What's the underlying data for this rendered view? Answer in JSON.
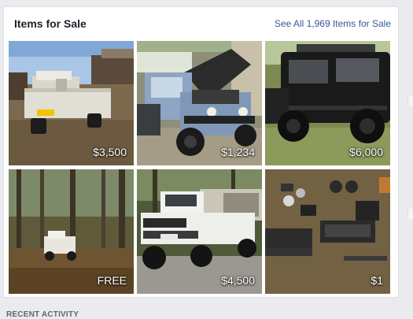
{
  "section": {
    "title": "Items for Sale",
    "see_all": "See All 1,969 Items for Sale"
  },
  "items": [
    {
      "price": "$3,500",
      "photo": "white-tray-ute-in-yard"
    },
    {
      "price": "$1,234",
      "photo": "blue-suzuki-hood-open"
    },
    {
      "price": "$6,000",
      "photo": "black-suzuki-4x4"
    },
    {
      "price": "FREE",
      "photo": "white-ute-in-bush"
    },
    {
      "price": "$4,500",
      "photo": "white-nissan-tray-ute"
    },
    {
      "price": "$1",
      "photo": "car-parts-on-ground"
    }
  ],
  "recent_activity": "RECENT ACTIVITY"
}
